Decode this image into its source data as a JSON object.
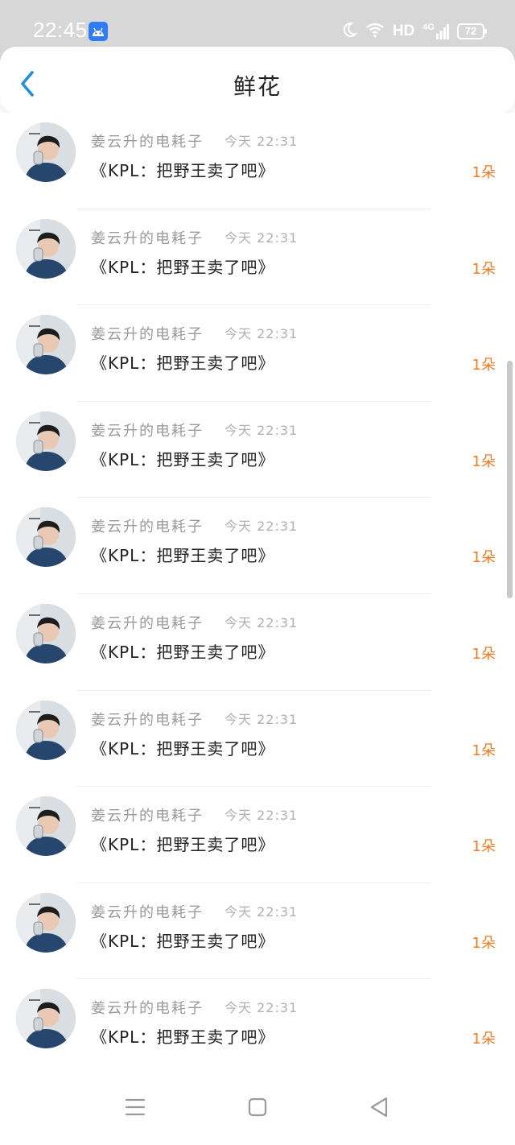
{
  "status_bar": {
    "time": "22:45",
    "app_icon": "android-app-icon",
    "icons": [
      "moon-icon",
      "wifi-icon"
    ],
    "hd_label": "HD",
    "network_label": "4G",
    "battery": "72"
  },
  "header": {
    "back_icon": "chevron-left-icon",
    "title": "鲜花"
  },
  "colors": {
    "accent_blue": "#1e8fe0",
    "gift_orange": "#f07a1f",
    "status_bar_bg": "#d7d7d7"
  },
  "gifts": [
    {
      "sender": "姜云升的电耗子",
      "time": "今天 22:31",
      "message": "《KPL：把野王卖了吧》",
      "count": "1朵"
    },
    {
      "sender": "姜云升的电耗子",
      "time": "今天 22:31",
      "message": "《KPL：把野王卖了吧》",
      "count": "1朵"
    },
    {
      "sender": "姜云升的电耗子",
      "time": "今天 22:31",
      "message": "《KPL：把野王卖了吧》",
      "count": "1朵"
    },
    {
      "sender": "姜云升的电耗子",
      "time": "今天 22:31",
      "message": "《KPL：把野王卖了吧》",
      "count": "1朵"
    },
    {
      "sender": "姜云升的电耗子",
      "time": "今天 22:31",
      "message": "《KPL：把野王卖了吧》",
      "count": "1朵"
    },
    {
      "sender": "姜云升的电耗子",
      "time": "今天 22:31",
      "message": "《KPL：把野王卖了吧》",
      "count": "1朵"
    },
    {
      "sender": "姜云升的电耗子",
      "time": "今天 22:31",
      "message": "《KPL：把野王卖了吧》",
      "count": "1朵"
    },
    {
      "sender": "姜云升的电耗子",
      "time": "今天 22:31",
      "message": "《KPL：把野王卖了吧》",
      "count": "1朵"
    },
    {
      "sender": "姜云升的电耗子",
      "time": "今天 22:31",
      "message": "《KPL：把野王卖了吧》",
      "count": "1朵"
    },
    {
      "sender": "姜云升的电耗子",
      "time": "今天 22:31",
      "message": "《KPL：把野王卖了吧》",
      "count": "1朵"
    }
  ],
  "nav_bar": {
    "buttons": [
      "menu-icon",
      "home-square-icon",
      "back-triangle-icon"
    ]
  }
}
